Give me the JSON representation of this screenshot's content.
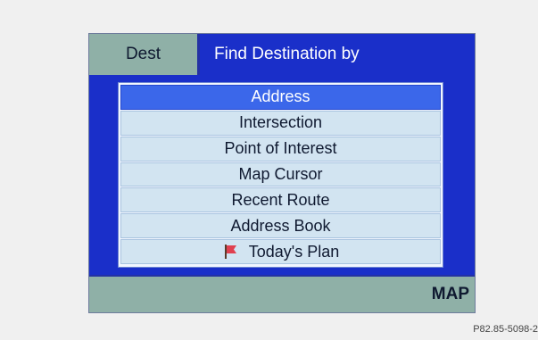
{
  "header": {
    "dest_tab_label": "Dest",
    "title": "Find Destination by"
  },
  "menu": {
    "items": [
      {
        "label": "Address",
        "selected": true
      },
      {
        "label": "Intersection",
        "selected": false
      },
      {
        "label": "Point of Interest",
        "selected": false
      },
      {
        "label": "Map Cursor",
        "selected": false
      },
      {
        "label": "Recent Route",
        "selected": false
      },
      {
        "label": "Address Book",
        "selected": false
      },
      {
        "label": "Today's Plan",
        "selected": false,
        "icon": "flag-icon"
      }
    ]
  },
  "bottom_bar": {
    "map_label": "MAP"
  },
  "caption": "P82.85-5098-2",
  "colors": {
    "frame": "#1a2fc9",
    "tab": "#8fb0a7",
    "selected": "#3b67ea",
    "item": "#d2e4f1",
    "flag": "#e0404f"
  }
}
